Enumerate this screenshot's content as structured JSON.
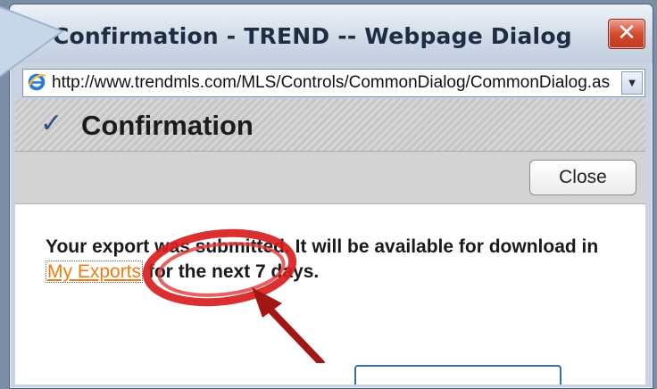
{
  "window": {
    "title": "Confirmation - TREND -- Webpage Dialog",
    "close_glyph": "✕",
    "url": "http://www.trendmls.com/MLS/Controls/CommonDialog/CommonDialog.aspx",
    "dropdown_glyph": "▼"
  },
  "dialog": {
    "check_glyph": "✓",
    "heading": "Confirmation",
    "close_button": "Close",
    "message_before": "Your export was submitted. It will be available for download in ",
    "message_link": "My Exports",
    "message_after": " for the next 7 days."
  },
  "colors": {
    "link": "#f07b12",
    "annotation": "#d81e1e",
    "title_close": "#d44a2f"
  },
  "icons": [
    "ie-icon",
    "check-icon",
    "close-icon",
    "chevron-down-icon"
  ]
}
